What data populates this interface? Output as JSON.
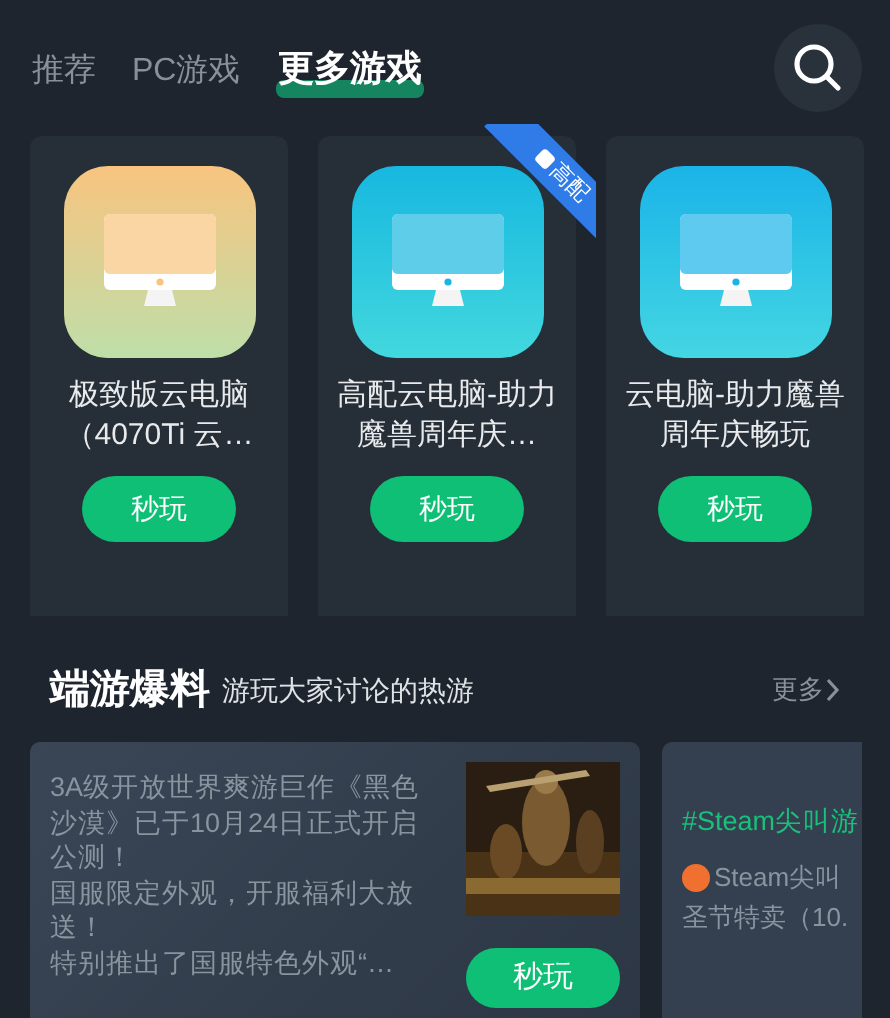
{
  "tabs": [
    {
      "label": "推荐",
      "selected": false
    },
    {
      "label": "PC游戏",
      "selected": false
    },
    {
      "label": "更多游戏",
      "selected": true
    }
  ],
  "cloud_pcs": [
    {
      "title": "极致版云电脑（4070Ti 云…",
      "color": "#f8c47f",
      "button": "秒玩"
    },
    {
      "title": "高配云电脑-助力魔兽周年庆…",
      "color": "#17b8e0",
      "badge": "高配",
      "button": "秒玩"
    },
    {
      "title": "云电脑-助力魔兽周年庆畅玩",
      "color": "#1ab4e8",
      "button": "秒玩"
    }
  ],
  "section": {
    "title": "端游爆料",
    "subtitle": "游玩大家讨论的热游",
    "more": "更多"
  },
  "posts": [
    {
      "kind": "game",
      "paragraphs": [
        "3A级开放世界爽游巨作《黑色沙漠》已于10月24日正式开启公测！",
        "国服限定外观，开服福利大放送！",
        "特别推出了国服特色外观“…"
      ],
      "button": "秒玩"
    },
    {
      "kind": "topic",
      "hashtag": "#Steam尖叫游",
      "author": "Steam尖叫",
      "text": "圣节特卖（10."
    }
  ]
}
